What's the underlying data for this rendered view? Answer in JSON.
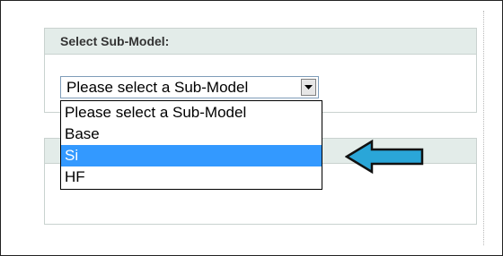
{
  "panel_sub_model": {
    "title": "Select Sub-Model:"
  },
  "sub_model_select": {
    "value": "Please select a Sub-Model",
    "options": [
      {
        "label": "Please select a Sub-Model",
        "selected": false
      },
      {
        "label": "Base",
        "selected": false
      },
      {
        "label": "Si",
        "selected": true
      },
      {
        "label": "HF",
        "selected": false
      }
    ]
  },
  "colors": {
    "panel_header_bg": "#e3ece9",
    "selection_highlight": "#3399ff",
    "annotation_arrow_fill": "#2aa6d8"
  },
  "icons": {
    "dropdown_arrow": "chevron-down-icon",
    "annotation": "left-arrow-icon"
  }
}
